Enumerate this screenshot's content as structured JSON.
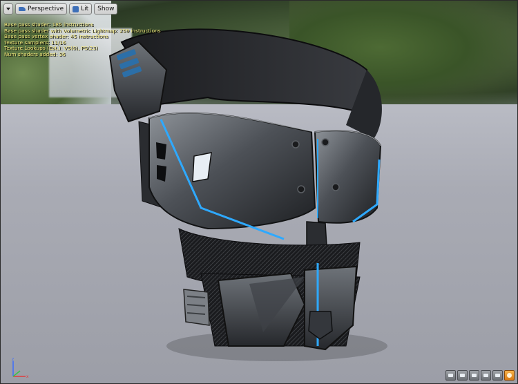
{
  "toolbar": {
    "view_mode": "Perspective",
    "lighting_mode": "Lit",
    "show_label": "Show"
  },
  "stats_lines": [
    "Base pass shader: 185 instructions",
    "Base pass shader with Volumetric Lightmap: 259 instructions",
    "Base pass vertex shader: 45 instructions",
    "Texture samplers: 11/16",
    "Texture Lookups (Est.): VS(0), PS(23)",
    "Num shaders added: 36"
  ],
  "bottom_buttons": [
    {
      "icon": "realtime-icon"
    },
    {
      "icon": "viewport-view-icon"
    },
    {
      "icon": "grid-icon"
    },
    {
      "icon": "floor-icon"
    },
    {
      "icon": "sky-icon"
    },
    {
      "icon": "sphere-preview-icon"
    }
  ],
  "colors": {
    "accent_blue": "#2ea9ff",
    "stats_text": "#f0e47a"
  }
}
